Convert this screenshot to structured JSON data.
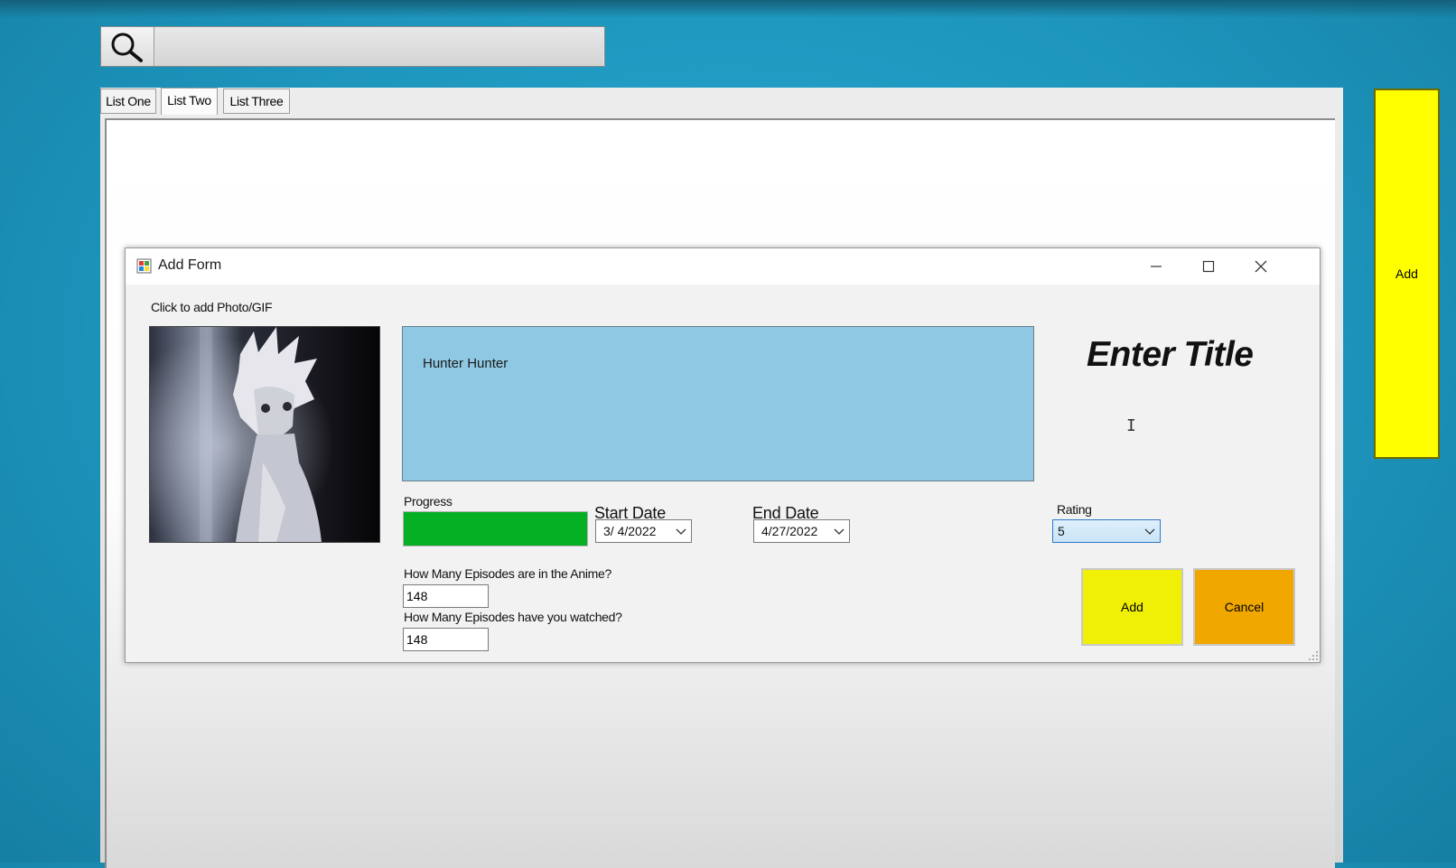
{
  "search": {
    "icon": "search-icon",
    "value": ""
  },
  "tabs": [
    {
      "label": "List One",
      "active": false
    },
    {
      "label": "List Two",
      "active": true
    },
    {
      "label": "List Three",
      "active": false
    }
  ],
  "side_add_label": "Add",
  "dialog": {
    "title": "Add Form",
    "photo_label": "Click to add Photo/GIF",
    "description": "Hunter Hunter",
    "title_placeholder": "Enter Title",
    "progress_label": "Progress",
    "progress_value": 1.0,
    "start_date_label": "Start Date",
    "start_date": "3/ 4/2022",
    "end_date_label": "End Date",
    "end_date": "4/27/2022",
    "rating_label": "Rating",
    "rating_value": "5",
    "episodes_total_label": "How Many Episodes are in the Anime?",
    "episodes_total": "148",
    "episodes_watched_label": "How Many Episodes have you watched?",
    "episodes_watched": "148",
    "add_label": "Add",
    "cancel_label": "Cancel"
  },
  "colors": {
    "background": "#1f98c0",
    "side_add": "#ffff00",
    "description_bg": "#8fc8e3",
    "progress_fill": "#06b025",
    "add_button": "#f0f006",
    "cancel_button": "#f0a800"
  }
}
